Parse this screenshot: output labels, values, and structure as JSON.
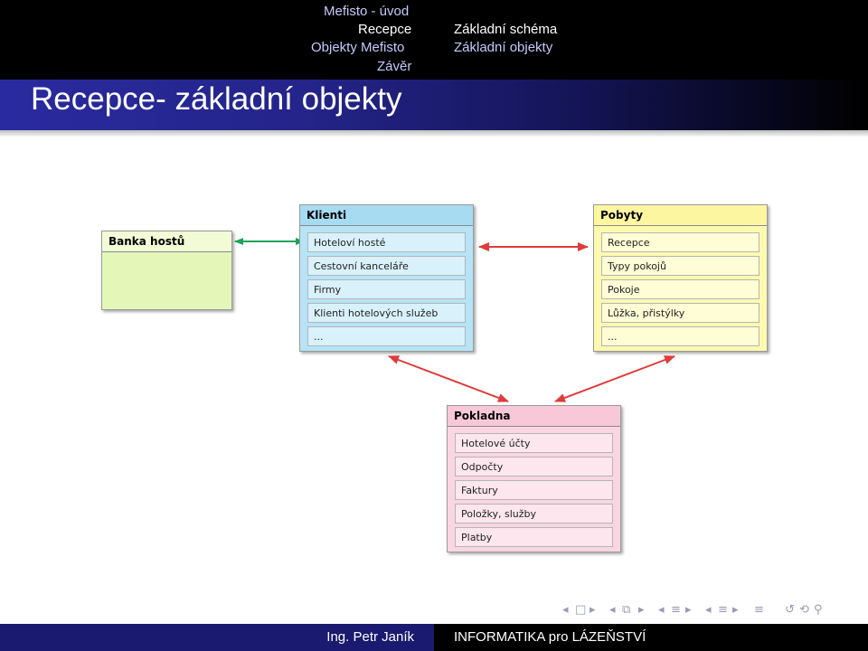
{
  "header": {
    "sections": [
      "Mefisto - úvod",
      "Recepce",
      "Objekty Mefisto",
      "Závěr"
    ],
    "subsections": [
      "Základní schéma",
      "Základní objekty"
    ]
  },
  "slide": {
    "title": "Recepce- základní objekty"
  },
  "diagram": {
    "boxes": [
      {
        "id": "banka",
        "title": "Banka hostů",
        "items": [],
        "color": "#e4f7b8",
        "head_color": "#f2fbd6"
      },
      {
        "id": "klienti",
        "title": "Klienti",
        "items": [
          "Hoteloví hosté",
          "Cestovní kanceláře",
          "Firmy",
          "Klienti hotelových služeb",
          "..."
        ],
        "color": "#b6e4f6",
        "head_color": "#a6dbf2"
      },
      {
        "id": "pobyty",
        "title": "Pobyty",
        "items": [
          "Recepce",
          "Typy pokojů",
          "Pokoje",
          "Lůžka, přistýlky",
          "..."
        ],
        "color": "#fdfab0",
        "head_color": "#fdf6a0"
      },
      {
        "id": "pokladna",
        "title": "Pokladna",
        "items": [
          "Hotelové účty",
          "Odpočty",
          "Faktury",
          "Položky, služby",
          "Platby"
        ],
        "color": "#fbd6e2",
        "head_color": "#f9c8d8"
      }
    ],
    "connectors": [
      {
        "from": "banka",
        "to": "klienti",
        "color": "#1aa35a"
      },
      {
        "from": "klienti",
        "to": "pobyty",
        "color": "#e03b3b"
      },
      {
        "from": "klienti",
        "to": "pokladna",
        "color": "#e03b3b"
      },
      {
        "from": "pobyty",
        "to": "pokladna",
        "color": "#e03b3b"
      }
    ]
  },
  "footer": {
    "author": "Ing. Petr Janík",
    "title": "INFORMATIKA pro LÁZEŇSTVÍ"
  },
  "beamer_nav": {
    "icons": [
      "nav-left-arrow-icon",
      "frame-icon",
      "nav-right-arrow-icon",
      "subsection-icon",
      "section-icon",
      "presentation-icon",
      "search-icon"
    ]
  }
}
